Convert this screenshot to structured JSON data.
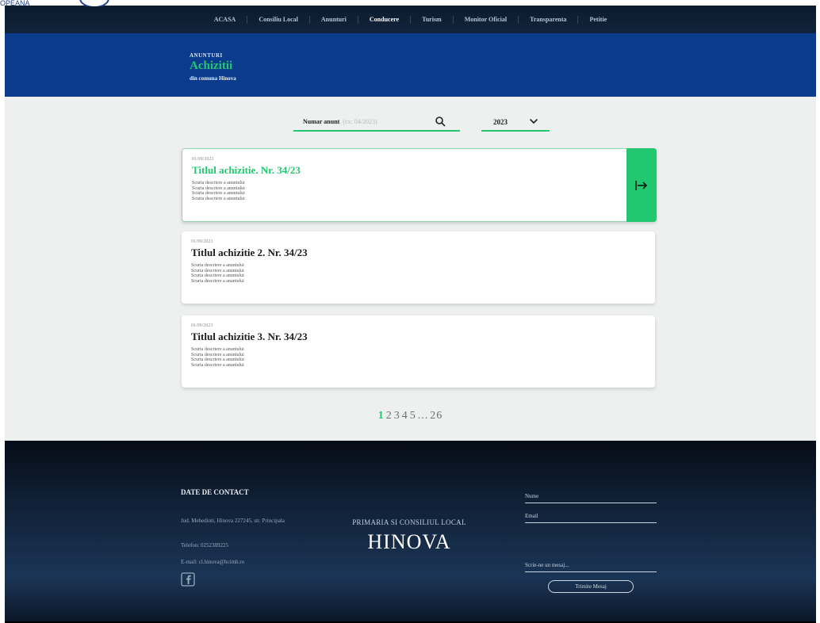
{
  "corner": {
    "logo_text": "OPEANA"
  },
  "nav": {
    "items": [
      {
        "label": "ACASA"
      },
      {
        "label": "Consiliu Local"
      },
      {
        "label": "Anunturi"
      },
      {
        "label": "Conducere"
      },
      {
        "label": "Turism"
      },
      {
        "label": "Monitor Oficial"
      },
      {
        "label": "Transparenta"
      },
      {
        "label": "Petitie"
      }
    ],
    "active_index": 3
  },
  "banner": {
    "kicker": "ANUNTURI",
    "title": "Achizitii",
    "subtitle": "din comuna Hinova"
  },
  "filters": {
    "search_label": "Numar anunt",
    "search_placeholder": "(ex: 04/2023)",
    "year_value": "2023"
  },
  "cards": [
    {
      "date": "01/09/2023",
      "title": "Titlul achizitie. Nr. 34/23",
      "desc": [
        "Scurta descriere a anuntului",
        "Scurta descriere a anuntului",
        "Scurta descriere a anuntului",
        "Scurta descriere a anuntului"
      ]
    },
    {
      "date": "01/09/2023",
      "title": "Titlul achizitie 2. Nr. 34/23",
      "desc": [
        "Scurta descriere a anuntului",
        "Scurta descriere a anuntului",
        "Scurta descriere a anuntului",
        "Scurta descriere a anuntului"
      ]
    },
    {
      "date": "01/09/2023",
      "title": "Titlul achizitie 3. Nr. 34/23",
      "desc": [
        "Scurta descriere a anuntului",
        "Scurta descriere a anuntului",
        "Scurta descriere a anuntului",
        "Scurta descriere a anuntului"
      ]
    }
  ],
  "pagination": {
    "pages": [
      "1",
      "2",
      "3",
      "4",
      "5"
    ],
    "ellipsis": "...",
    "last": "26",
    "current": "1"
  },
  "footer": {
    "contact_title": "DATE DE CONTACT",
    "address": "Jud. Mehedinti, Hinova 227245, str. Principala",
    "phone": "Telefon: 0252389225",
    "email": "E-mail: cl.hinova@hcimh.ro",
    "brand_sub": "PRIMARIA SI CONSILIUL LOCAL",
    "brand_main": "HINOVA",
    "form": {
      "name_label": "Nume",
      "email_label": "Email",
      "message_label": "Scrie-ne un mesaj...",
      "send_label": "Trimite Mesaj"
    }
  },
  "colors": {
    "accent": "#22c870",
    "nav_bg": "#0b1a2e",
    "banner_bg": "#0a3b8c",
    "page_bg": "#eef0f0"
  }
}
